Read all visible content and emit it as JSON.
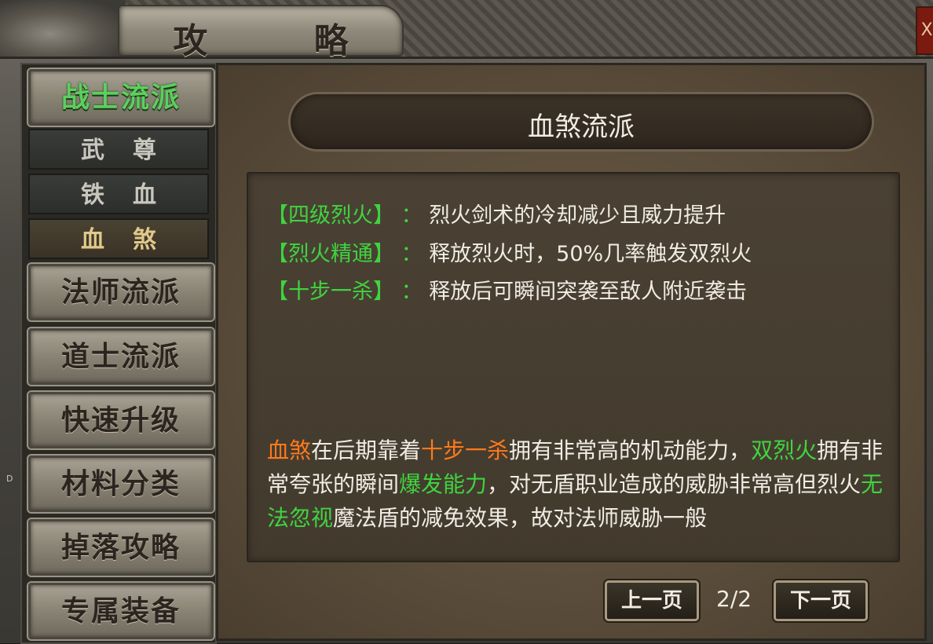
{
  "header": {
    "title": "攻 略",
    "close_label": "X"
  },
  "sidebar": {
    "categories": [
      {
        "label": "战士流派"
      },
      {
        "label": "法师流派"
      },
      {
        "label": "道士流派"
      },
      {
        "label": "快速升级"
      },
      {
        "label": "材料分类"
      },
      {
        "label": "掉落攻略"
      },
      {
        "label": "专属装备"
      }
    ],
    "subitems": [
      {
        "label": "武尊"
      },
      {
        "label": "铁血"
      },
      {
        "label": "血煞"
      }
    ]
  },
  "content": {
    "title": "血煞流派",
    "skills": [
      {
        "name": "【四级烈火】",
        "sep": "：",
        "desc": "烈火剑术的冷却减少且威力提升"
      },
      {
        "name": "【烈火精通】",
        "sep": "：",
        "desc": "释放烈火时，50%几率触发双烈火"
      },
      {
        "name": "【十步一杀】",
        "sep": "：",
        "desc": "释放后可瞬间突袭至敌人附近袭击"
      }
    ],
    "desc": {
      "p1": "血煞",
      "p2": "在后期靠着",
      "p3": "十步一杀",
      "p4": "拥有非常高的机动能力，",
      "p5": "双烈火",
      "p6": "拥有非常夸张的瞬间",
      "p7": "爆发能力",
      "p8": "，对无盾职业造成的威胁非常高但烈火",
      "p9": "无法忽视",
      "p10": "魔法盾的减免效果，故对法师威胁一般"
    }
  },
  "pager": {
    "prev_label": "上一页",
    "page": "2/2",
    "next_label": "下一页"
  },
  "edge_label": "D",
  "colors": {
    "skill_green": "#3fd43f",
    "highlight_orange": "#ff7a1a",
    "text": "#f0ece4"
  }
}
